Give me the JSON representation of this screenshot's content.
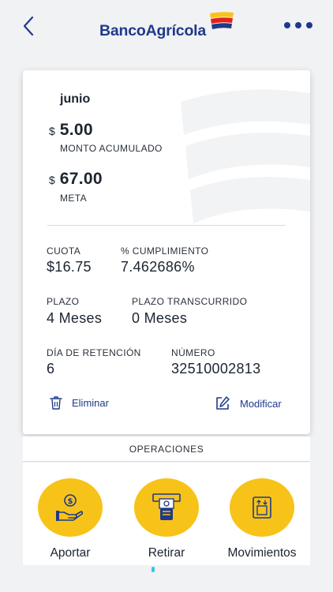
{
  "header": {
    "back_icon": "chevron-left-icon",
    "logo_text": "BancoAgrícola",
    "more_icon": "more-horizontal-icon"
  },
  "colors": {
    "brand_blue": "#1f3a8a",
    "accent_yellow": "#f7c318",
    "logo_red": "#e2231a",
    "indicator_cyan": "#38c5e4"
  },
  "goal": {
    "month": "junio",
    "accumulated": {
      "currency": "$",
      "value": "5.00",
      "label": "MONTO ACUMULADO"
    },
    "target": {
      "currency": "$",
      "value": "67.00",
      "label": "META"
    },
    "fields": {
      "cuota": {
        "label": "CUOTA",
        "value": "$16.75"
      },
      "cumplimiento": {
        "label": "% CUMPLIMIENTO",
        "value": "7.462686%"
      },
      "plazo": {
        "label": "PLAZO",
        "value": "4 Meses"
      },
      "plazo_transcurrido": {
        "label": "PLAZO TRANSCURRIDO",
        "value": "0 Meses"
      },
      "dia_retencion": {
        "label": "DÍA DE RETENCIÓN",
        "value": "6"
      },
      "numero": {
        "label": "NÚMERO",
        "value": "32510002813"
      }
    },
    "actions": {
      "delete": {
        "label": "Eliminar",
        "icon": "trash-icon"
      },
      "edit": {
        "label": "Modificar",
        "icon": "edit-icon"
      }
    }
  },
  "operations": {
    "title": "OPERACIONES",
    "items": [
      {
        "label": "Aportar",
        "icon": "hand-coin-icon"
      },
      {
        "label": "Retirar",
        "icon": "atm-withdraw-icon"
      },
      {
        "label": "Movimientos",
        "icon": "transfer-box-icon"
      }
    ]
  }
}
